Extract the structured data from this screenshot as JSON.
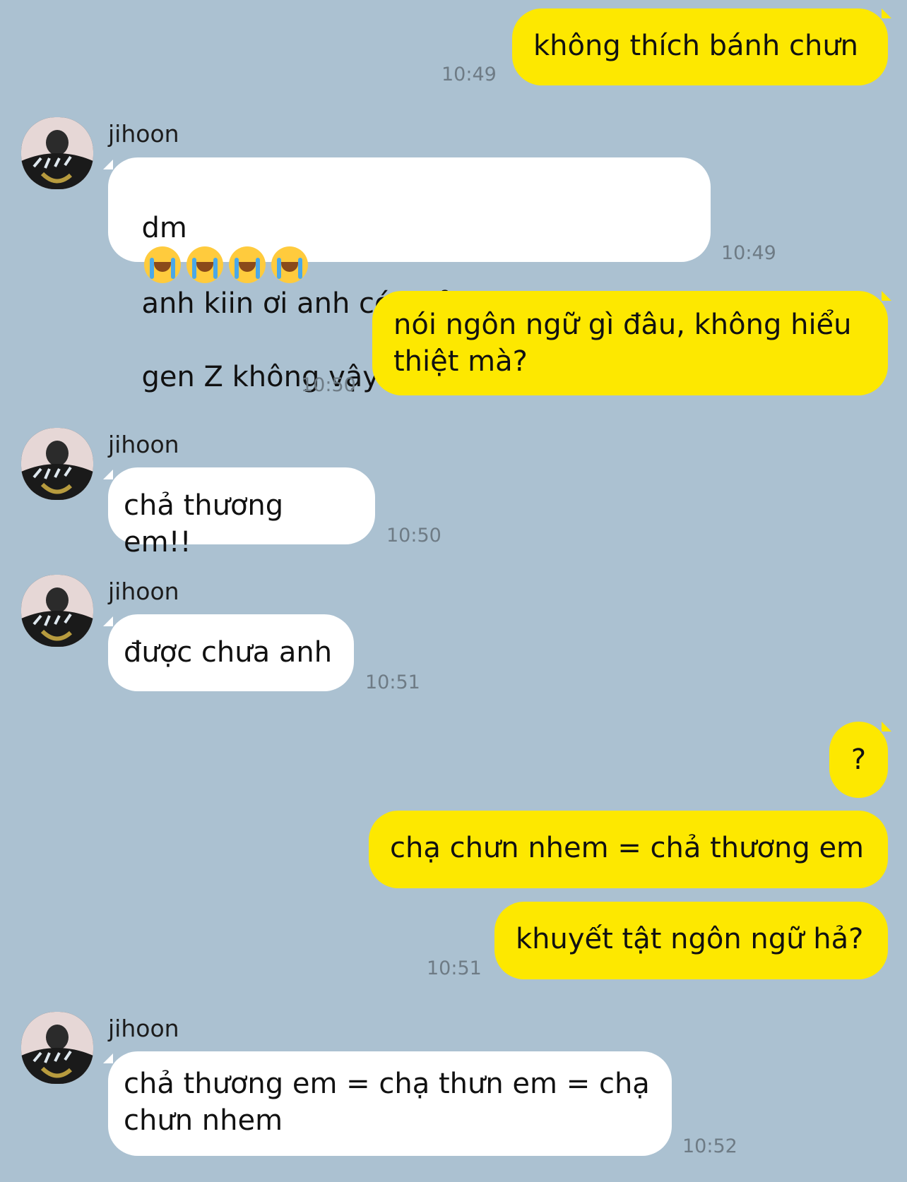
{
  "contact": {
    "name": "jihoon"
  },
  "messages": [
    {
      "from": "me",
      "text": "không thích bánh chưn",
      "time": "10:49"
    },
    {
      "from": "them",
      "sender": "jihoon",
      "text_pre": "dm",
      "emoji_count": 4,
      "emoji": "loudly-crying-face",
      "text_post": "anh kiin ơi anh có phải",
      "text_line2": "gen Z không vậy???",
      "time": "10:49"
    },
    {
      "from": "me",
      "text": "nói ngôn ngữ gì đâu, không hiểu\nthiệt mà?",
      "time": "10:50"
    },
    {
      "from": "them",
      "sender": "jihoon",
      "text": "chả thương em!!",
      "time": "10:50"
    },
    {
      "from": "them",
      "sender": "jihoon",
      "text": "được chưa anh",
      "time": "10:51"
    },
    {
      "from": "me",
      "text": "?",
      "time": ""
    },
    {
      "from": "me",
      "text": "chạ chưn nhem = chả thương em",
      "time": ""
    },
    {
      "from": "me",
      "text": "khuyết tật ngôn ngữ hả?",
      "time": "10:51"
    },
    {
      "from": "them",
      "sender": "jihoon",
      "text": "chả thương em = chạ thưn em = chạ\nchưn nhem",
      "time": "10:52"
    }
  ],
  "colors": {
    "background": "#abc1d1",
    "outgoing": "#fde800",
    "incoming": "#ffffff"
  }
}
